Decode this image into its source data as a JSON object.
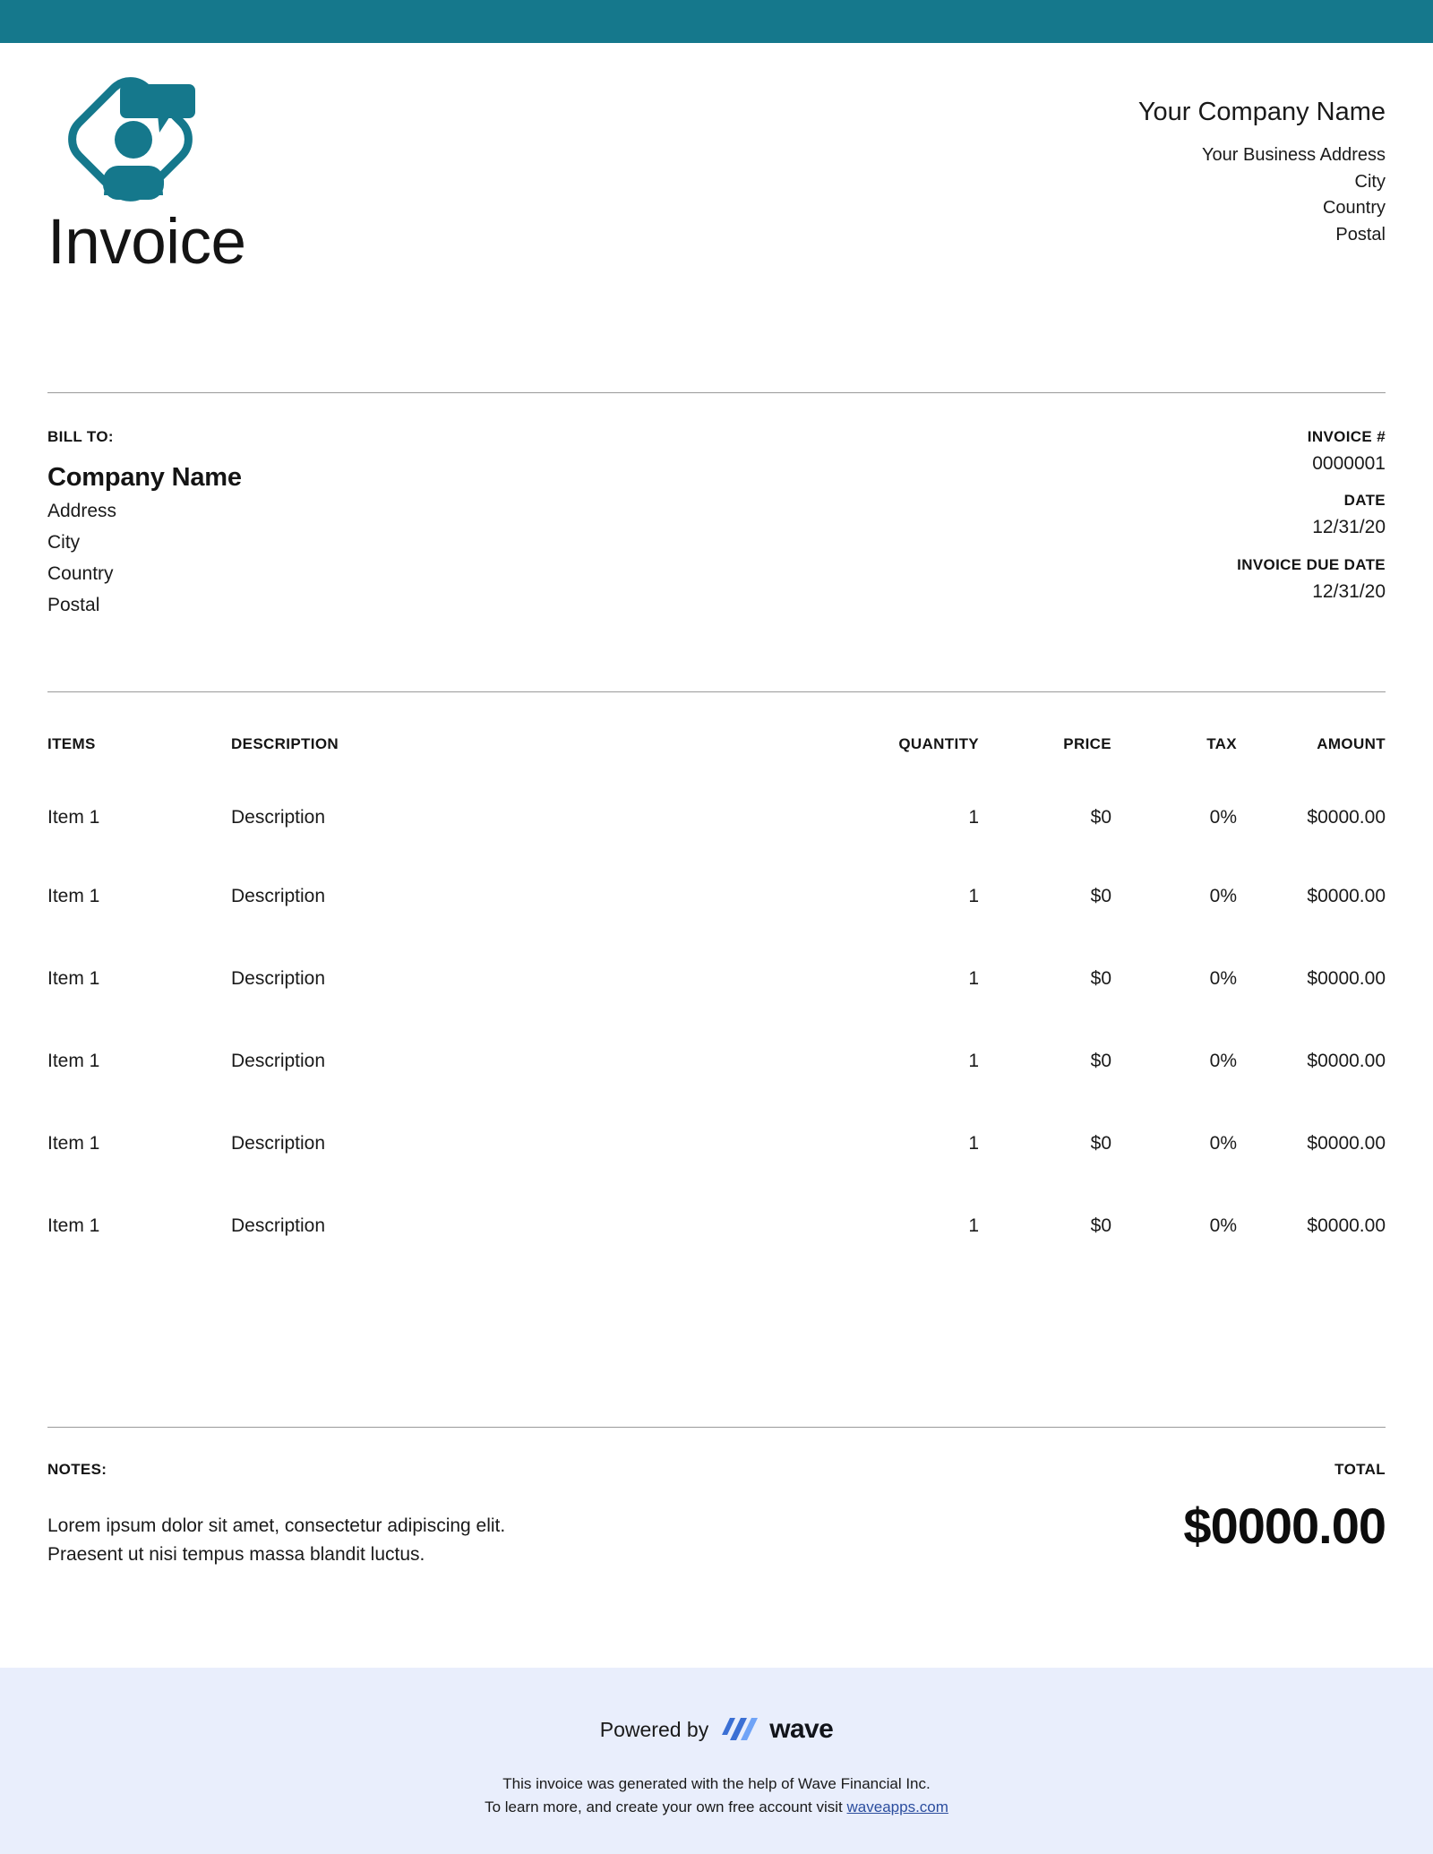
{
  "theme": {
    "accent_teal": "#15788c",
    "footer_bg": "#e9eefc",
    "rule_color": "#9a9a9a",
    "link_color": "#2b4d9e",
    "wave_blue_dark": "#3b6fd4",
    "wave_blue_light": "#6fa3f7"
  },
  "header": {
    "document_title": "Invoice",
    "logo_name": "speech-bubble-person-diamond-logo",
    "company_name": "Your Company Name",
    "company_address": [
      "Your Business Address",
      "City",
      "Country",
      "Postal"
    ]
  },
  "bill_to": {
    "label": "BILL TO:",
    "company": "Company Name",
    "lines": [
      "Address",
      "City",
      "Country",
      "Postal"
    ]
  },
  "invoice_meta": {
    "number_label": "INVOICE #",
    "number_value": "0000001",
    "date_label": "DATE",
    "date_value": "12/31/20",
    "due_label": "INVOICE DUE DATE",
    "due_value": "12/31/20"
  },
  "items_table": {
    "columns": [
      "ITEMS",
      "DESCRIPTION",
      "QUANTITY",
      "PRICE",
      "TAX",
      "AMOUNT"
    ],
    "rows": [
      {
        "item": "Item 1",
        "description": "Description",
        "quantity": "1",
        "price": "$0",
        "tax": "0%",
        "amount": "$0000.00"
      },
      {
        "item": "Item 1",
        "description": "Description",
        "quantity": "1",
        "price": "$0",
        "tax": "0%",
        "amount": "$0000.00"
      },
      {
        "item": "Item 1",
        "description": "Description",
        "quantity": "1",
        "price": "$0",
        "tax": "0%",
        "amount": "$0000.00"
      },
      {
        "item": "Item 1",
        "description": "Description",
        "quantity": "1",
        "price": "$0",
        "tax": "0%",
        "amount": "$0000.00"
      },
      {
        "item": "Item 1",
        "description": "Description",
        "quantity": "1",
        "price": "$0",
        "tax": "0%",
        "amount": "$0000.00"
      },
      {
        "item": "Item 1",
        "description": "Description",
        "quantity": "1",
        "price": "$0",
        "tax": "0%",
        "amount": "$0000.00"
      }
    ]
  },
  "notes": {
    "label": "NOTES:",
    "line_1": "Lorem ipsum dolor sit amet, consectetur adipiscing elit.",
    "line_2": "Praesent ut nisi tempus massa blandit luctus."
  },
  "total": {
    "label": "TOTAL",
    "value": "$0000.00"
  },
  "footer": {
    "powered_by": "Powered by",
    "wave_wordmark": "wave",
    "wave_mark_name": "wave-logo-icon",
    "note_line_1": "This invoice was generated with the help of Wave Financial Inc.",
    "note_line_2_prefix": "To learn more, and create your own free account visit ",
    "link_text": "waveapps.com"
  }
}
